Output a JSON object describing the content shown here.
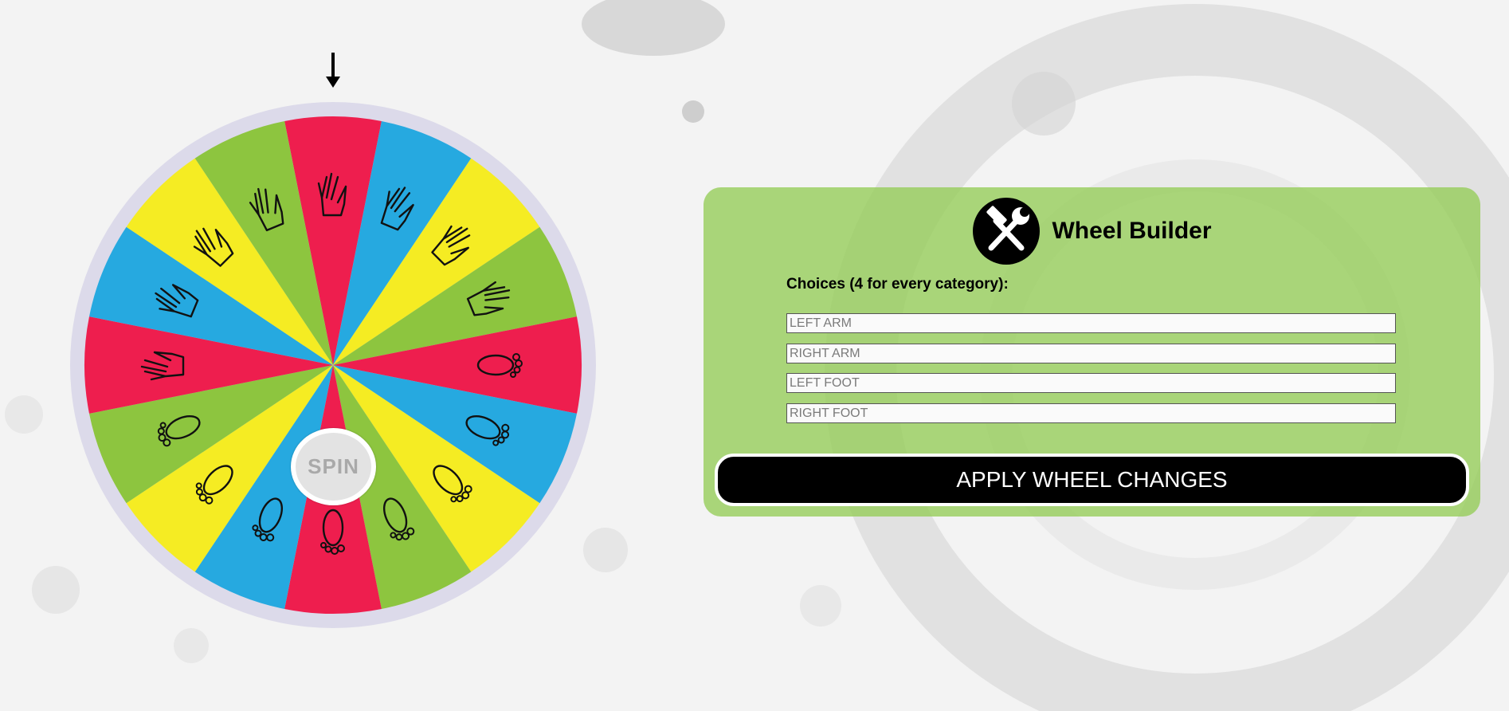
{
  "spin_button": {
    "label": "SPIN"
  },
  "wheel": {
    "segment_colors": [
      "#ee1e4e",
      "#26a9e0",
      "#f5ec23",
      "#8dc53f",
      "#ee1e4e",
      "#26a9e0",
      "#f5ec23",
      "#8dc53f",
      "#ee1e4e",
      "#26a9e0",
      "#f5ec23",
      "#8dc53f",
      "#ee1e4e",
      "#26a9e0",
      "#f5ec23",
      "#8dc53f"
    ],
    "segment_icons": [
      "hand-icon",
      "hand-icon",
      "hand-icon",
      "hand-icon",
      "foot-icon",
      "foot-icon",
      "foot-icon",
      "foot-icon",
      "foot-icon",
      "foot-icon",
      "foot-icon",
      "foot-icon",
      "hand-icon",
      "hand-icon",
      "hand-icon",
      "hand-icon"
    ],
    "rim_color": "#dcdaea",
    "pointer_icon": "arrow-down-icon"
  },
  "builder": {
    "icon": "hammer-wrench-icon",
    "title": "Wheel Builder",
    "choices_label": "Choices (4 for every category):",
    "inputs": [
      {
        "placeholder": "LEFT ARM",
        "value": ""
      },
      {
        "placeholder": "RIGHT ARM",
        "value": ""
      },
      {
        "placeholder": "LEFT FOOT",
        "value": ""
      },
      {
        "placeholder": "RIGHT FOOT",
        "value": ""
      }
    ],
    "apply_label": "APPLY WHEEL CHANGES"
  }
}
